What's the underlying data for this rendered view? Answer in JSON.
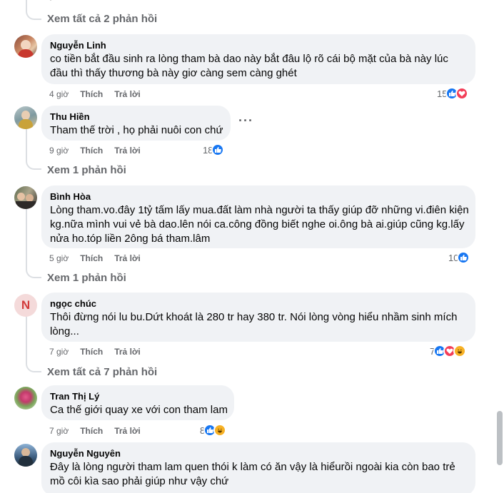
{
  "comments": [
    {
      "author": "Nguyễn Linh",
      "lines": [
        "co tiền bắt đầu sinh ra lòng tham bà dao này bắt đâu lộ rõ cái bộ mặt của bà này lúc",
        "đầu thì thấy thương bà này giơ càng sem càng ghét"
      ],
      "time": "4 giờ",
      "like": "Thích",
      "reply": "Trả lời",
      "reaction_count": "15",
      "reactions": [
        "like",
        "love"
      ]
    },
    {
      "author": "Thu Hiền",
      "lines": [
        "Tham thế trời , họ phải nuôi con chứ"
      ],
      "time": "9 giờ",
      "like": "Thích",
      "reply": "Trả lời",
      "reaction_count": "18",
      "reactions": [
        "like"
      ],
      "view_replies": "Xem 1 phản hồi"
    },
    {
      "author": "Bình Hòa",
      "lines": [
        "Lòng tham.vo.đây 1tỷ tấm lấy mua.đất làm nhà người ta thấy giúp đỡ những vi.điên kiện",
        "kg.nữa mình vui vẻ bà dao.lên nói ca.công đồng biết nghe oi.ông bà ai.giúp cũng kg.lấy",
        "nửa ho.tóp liền 2ông bá tham.lâm"
      ],
      "time": "5 giờ",
      "like": "Thích",
      "reply": "Trả lời",
      "reaction_count": "10",
      "reactions": [
        "like"
      ],
      "view_replies": "Xem 1 phản hồi"
    },
    {
      "author": "ngọc chúc",
      "avatar_letter": "N",
      "lines": [
        "Thôi đừng nói lu bu.Dứt khoát là 280 tr hay 380 tr. Nói lòng vòng hiểu nhầm sinh mích",
        "lòng..."
      ],
      "time": "7 giờ",
      "like": "Thích",
      "reply": "Trả lời",
      "reaction_count": "7",
      "reactions": [
        "like",
        "love",
        "haha"
      ],
      "view_replies": "Xem tất cả 7 phản hồi"
    },
    {
      "author": "Tran Thị Lý",
      "lines": [
        "Ca thế giới quay xe với con tham lam"
      ],
      "time": "7 giờ",
      "like": "Thích",
      "reply": "Trả lời",
      "reaction_count": "8",
      "reactions": [
        "like",
        "haha"
      ]
    },
    {
      "author": "Nguyễn Nguyên",
      "lines": [
        "Đây là lòng người tham lam quen thói k làm có ăn vậy là hiểurồi ngoài kia còn bao trẻ",
        "mồ côi kìa sao phải giúp như vậy chứ"
      ]
    }
  ],
  "top_view_replies": "Xem tất cả 2 phản hồi",
  "more_icon": "more-horizontal-icon",
  "colors": {
    "like": "#1877f2",
    "love": "#f33e58",
    "haha": "#f7b125",
    "bubble": "#f0f2f5",
    "meta": "#65676b"
  }
}
